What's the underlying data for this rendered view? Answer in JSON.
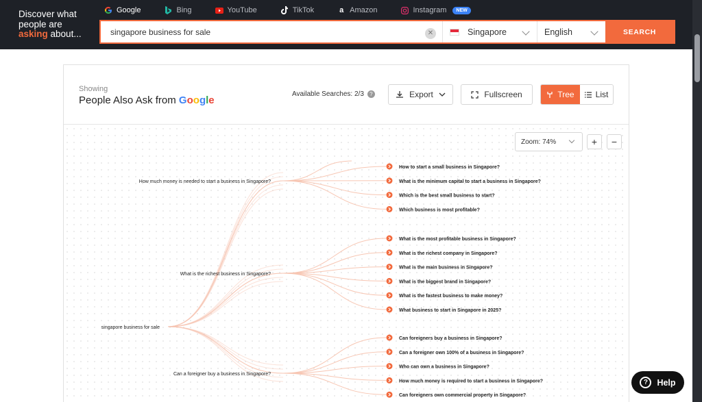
{
  "tagline": {
    "line1": "Discover what",
    "line2": "people are",
    "highlight": "asking",
    "line3_rest": " about..."
  },
  "engines": [
    {
      "label": "Google",
      "icon": "google-icon",
      "active": true
    },
    {
      "label": "Bing",
      "icon": "bing-icon"
    },
    {
      "label": "YouTube",
      "icon": "youtube-icon"
    },
    {
      "label": "TikTok",
      "icon": "tiktok-icon"
    },
    {
      "label": "Amazon",
      "icon": "amazon-icon"
    },
    {
      "label": "Instagram",
      "icon": "instagram-icon",
      "badge": "NEW"
    }
  ],
  "search": {
    "value": "singapore business for sale",
    "country": "Singapore",
    "language": "English",
    "button": "SEARCH"
  },
  "panel": {
    "showing": "Showing",
    "title": "People Also Ask from",
    "brand": "Google",
    "available": "Available Searches: 2/3",
    "export": "Export",
    "fullscreen": "Fullscreen",
    "tree": "Tree",
    "list": "List",
    "zoom": "Zoom: 74%",
    "zoom_in": "+",
    "zoom_out": "−"
  },
  "tree": {
    "root": "singapore business for sale",
    "branches": [
      {
        "question": "How much money is needed to start a business in Singapore?",
        "children": [
          "How to start a small business in Singapore?",
          "What is the minimum capital to start a business in Singapore?",
          "Which is the best small business to start?",
          "Which business is most profitable?"
        ]
      },
      {
        "question": "What is the richest business in Singapore?",
        "children": [
          "What is the most profitable business in Singapore?",
          "What is the richest company in Singapore?",
          "What is the main business in Singapore?",
          "What is the biggest brand in Singapore?",
          "What is the fastest business to make money?",
          "What business to start in Singapore in 2025?"
        ]
      },
      {
        "question": "Can a foreigner buy a business in Singapore?",
        "children": [
          "Can foreigners buy a business in Singapore?",
          "Can a foreigner own 100% of a business in Singapore?",
          "Who can own a business in Singapore?",
          "How much money is required to start a business in Singapore?",
          "Can foreigners own commercial property in Singapore?"
        ]
      }
    ]
  },
  "help": "Help",
  "colors": {
    "accent": "#f26a3d",
    "topbar": "#1e2127",
    "link": "#f7c6b3"
  }
}
